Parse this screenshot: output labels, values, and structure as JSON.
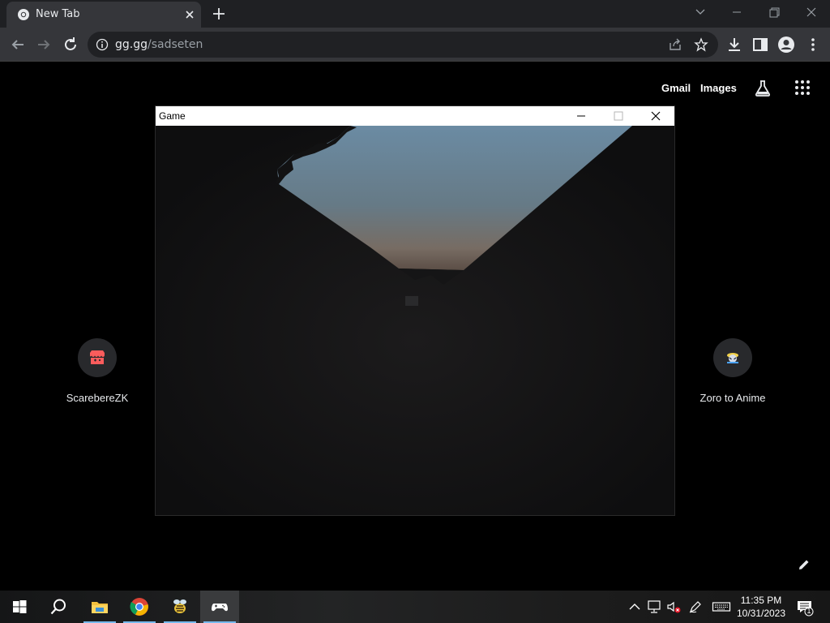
{
  "browser": {
    "tab": {
      "title": "New Tab",
      "favicon": "chrome-icon"
    },
    "url": {
      "host": "gg.gg",
      "path": "/sadseten"
    },
    "colors": {
      "frame": "#1f2023",
      "toolbar": "#35363a",
      "omnibox": "#202124"
    }
  },
  "ntp": {
    "header_links": {
      "gmail": "Gmail",
      "images": "Images"
    },
    "shortcuts": [
      {
        "label": "ScarebereZK",
        "icon": "itch-io-icon"
      },
      {
        "label": "Zoro to Anime",
        "icon": "zoro-icon"
      }
    ]
  },
  "game_window": {
    "title": "Game",
    "controls": [
      "minimize-icon",
      "maximize-icon",
      "close-icon"
    ]
  },
  "taskbar": {
    "items": [
      "start-icon",
      "search-icon",
      "file-explorer-icon",
      "chrome-icon",
      "bee-app-icon",
      "game-controller-icon"
    ],
    "clock": {
      "time": "11:35 PM",
      "date": "10/31/2023"
    },
    "notification_count": "1",
    "accent": "#76b9ed"
  }
}
